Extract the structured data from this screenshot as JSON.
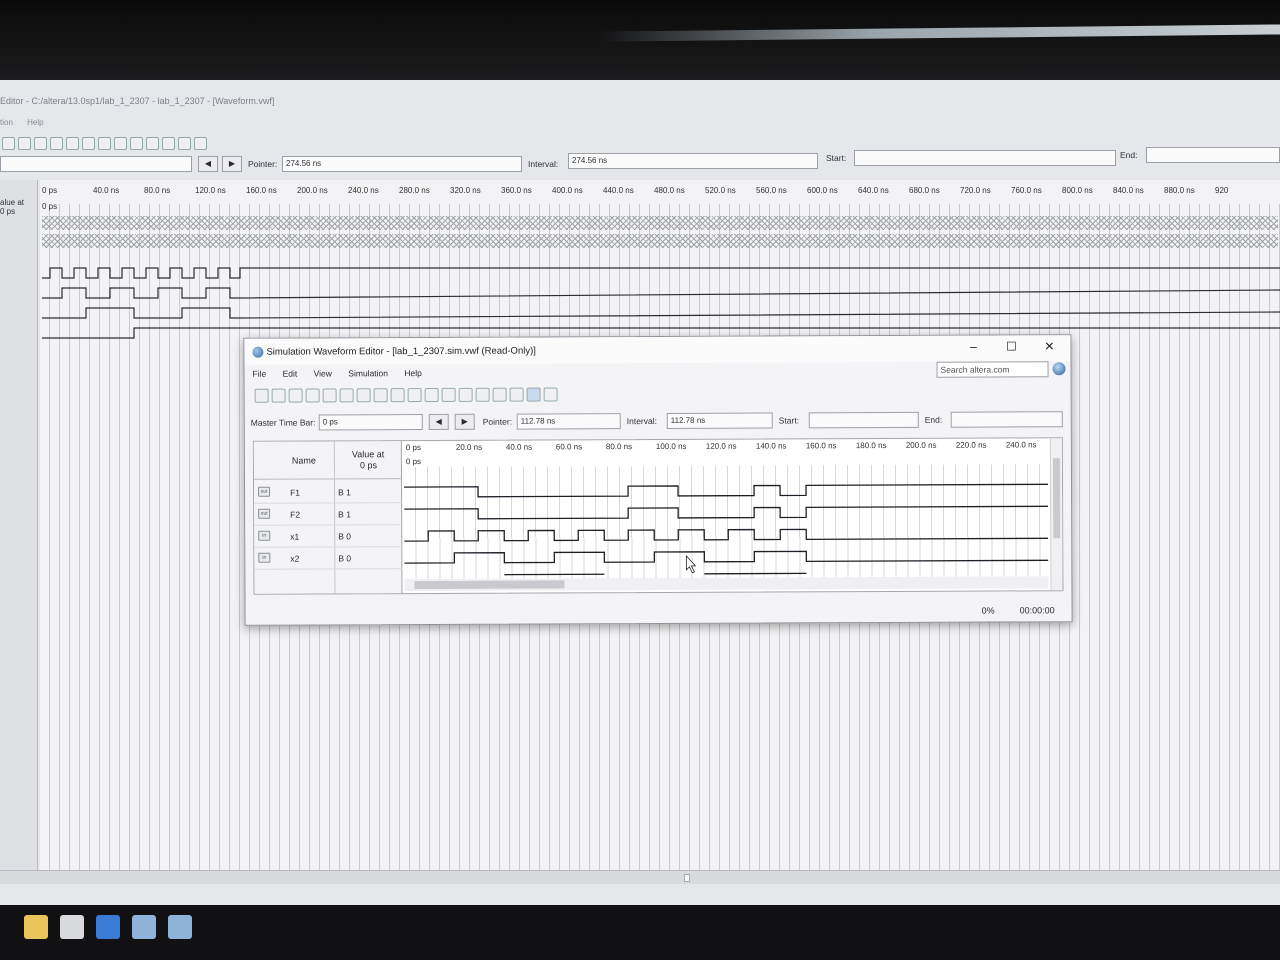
{
  "main_window": {
    "title": "Editor - C:/altera/13.0sp1/lab_1_2307 - lab_1_2307 - [Waveform.vwf]",
    "menu": [
      "tion",
      "Help"
    ],
    "pointer_label": "Pointer:",
    "pointer_value": "274.56 ns",
    "interval_label": "Interval:",
    "interval_value": "274.56 ns",
    "start_label": "Start:",
    "end_label": "End:",
    "value_col_header": "alue at",
    "value_col_sub": "0 ps",
    "time_sub": "0 ps",
    "ticks": [
      "0 ps",
      "40.0 ns",
      "80.0 ns",
      "120.0 ns",
      "160.0 ns",
      "200.0 ns",
      "240.0 ns",
      "280.0 ns",
      "320.0 ns",
      "360.0 ns",
      "400.0 ns",
      "440.0 ns",
      "480.0 ns",
      "520.0 ns",
      "560.0 ns",
      "600.0 ns",
      "640.0 ns",
      "680.0 ns",
      "720.0 ns",
      "760.0 ns",
      "800.0 ns",
      "840.0 ns",
      "880.0 ns",
      "920"
    ]
  },
  "dialog": {
    "title": "Simulation Waveform Editor - [lab_1_2307.sim.vwf (Read-Only)]",
    "menu": [
      "File",
      "Edit",
      "View",
      "Simulation",
      "Help"
    ],
    "search_placeholder": "Search altera.com",
    "master_label": "Master Time Bar:",
    "master_value": "0 ps",
    "pointer_label": "Pointer:",
    "pointer_value": "112.78 ns",
    "interval_label": "Interval:",
    "interval_value": "112.78 ns",
    "start_label": "Start:",
    "end_label": "End:",
    "name_header": "Name",
    "value_header": "Value at",
    "value_sub": "0 ps",
    "time_sub": "0 ps",
    "signals": [
      {
        "name": "F1",
        "value": "B 1",
        "icon": "out"
      },
      {
        "name": "F2",
        "value": "B 1",
        "icon": "out"
      },
      {
        "name": "x1",
        "value": "B 0",
        "icon": "in"
      },
      {
        "name": "x2",
        "value": "B 0",
        "icon": "in"
      }
    ],
    "ticks": [
      "0 ps",
      "20.0 ns",
      "40.0 ns",
      "60.0 ns",
      "80.0 ns",
      "100.0 ns",
      "120.0 ns",
      "140.0 ns",
      "160.0 ns",
      "180.0 ns",
      "200.0 ns",
      "220.0 ns",
      "240.0 ns"
    ],
    "status_percent": "0%",
    "status_time": "00:00:00"
  }
}
